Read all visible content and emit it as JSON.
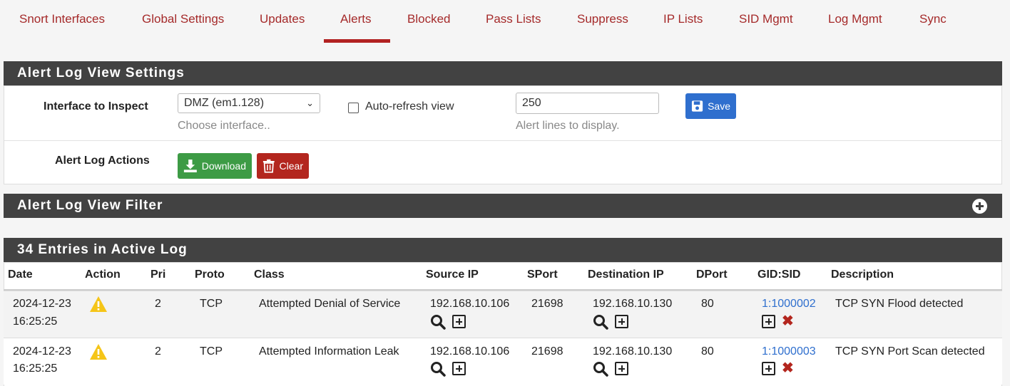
{
  "tabs": [
    {
      "label": "Snort Interfaces",
      "active": false
    },
    {
      "label": "Global Settings",
      "active": false
    },
    {
      "label": "Updates",
      "active": false
    },
    {
      "label": "Alerts",
      "active": true
    },
    {
      "label": "Blocked",
      "active": false
    },
    {
      "label": "Pass Lists",
      "active": false
    },
    {
      "label": "Suppress",
      "active": false
    },
    {
      "label": "IP Lists",
      "active": false
    },
    {
      "label": "SID Mgmt",
      "active": false
    },
    {
      "label": "Log Mgmt",
      "active": false
    },
    {
      "label": "Sync",
      "active": false
    }
  ],
  "settings": {
    "title": "Alert Log View Settings",
    "interface_label": "Interface to Inspect",
    "interface_value": "DMZ (em1.128)",
    "interface_help": "Choose interface..",
    "auto_refresh_label": "Auto-refresh view",
    "auto_refresh_checked": false,
    "lines_value": "250",
    "lines_help": "Alert lines to display.",
    "save_label": "Save",
    "actions_label": "Alert Log Actions",
    "download_label": "Download",
    "clear_label": "Clear"
  },
  "filter": {
    "title": "Alert Log View Filter"
  },
  "log": {
    "title": "34 Entries in Active Log",
    "columns": [
      "Date",
      "Action",
      "Pri",
      "Proto",
      "Class",
      "Source IP",
      "SPort",
      "Destination IP",
      "DPort",
      "GID:SID",
      "Description"
    ],
    "rows": [
      {
        "date": "2024-12-23",
        "time": "16:25:25",
        "pri": "2",
        "proto": "TCP",
        "class": "Attempted Denial of Service",
        "src_ip": "192.168.10.106",
        "sport": "21698",
        "dst_ip": "192.168.10.130",
        "dport": "80",
        "gidsid": "1:1000002",
        "description": "TCP SYN Flood detected"
      },
      {
        "date": "2024-12-23",
        "time": "16:25:25",
        "pri": "2",
        "proto": "TCP",
        "class": "Attempted Information Leak",
        "src_ip": "192.168.10.106",
        "sport": "21698",
        "dst_ip": "192.168.10.130",
        "dport": "80",
        "gidsid": "1:1000003",
        "description": "TCP SYN Port Scan detected"
      }
    ]
  },
  "colors": {
    "accent": "#b22222",
    "panel_header": "#424242",
    "save_button": "#2f6fce",
    "download_button": "#3d9b45",
    "clear_button": "#b3261e",
    "warning": "#f5c518"
  },
  "icons": [
    "floppy-disk-icon",
    "download-icon",
    "trash-icon",
    "plus-circle-icon",
    "warning-icon",
    "magnifier-icon",
    "box-plus-icon",
    "x-icon",
    "chevron-down-icon"
  ]
}
